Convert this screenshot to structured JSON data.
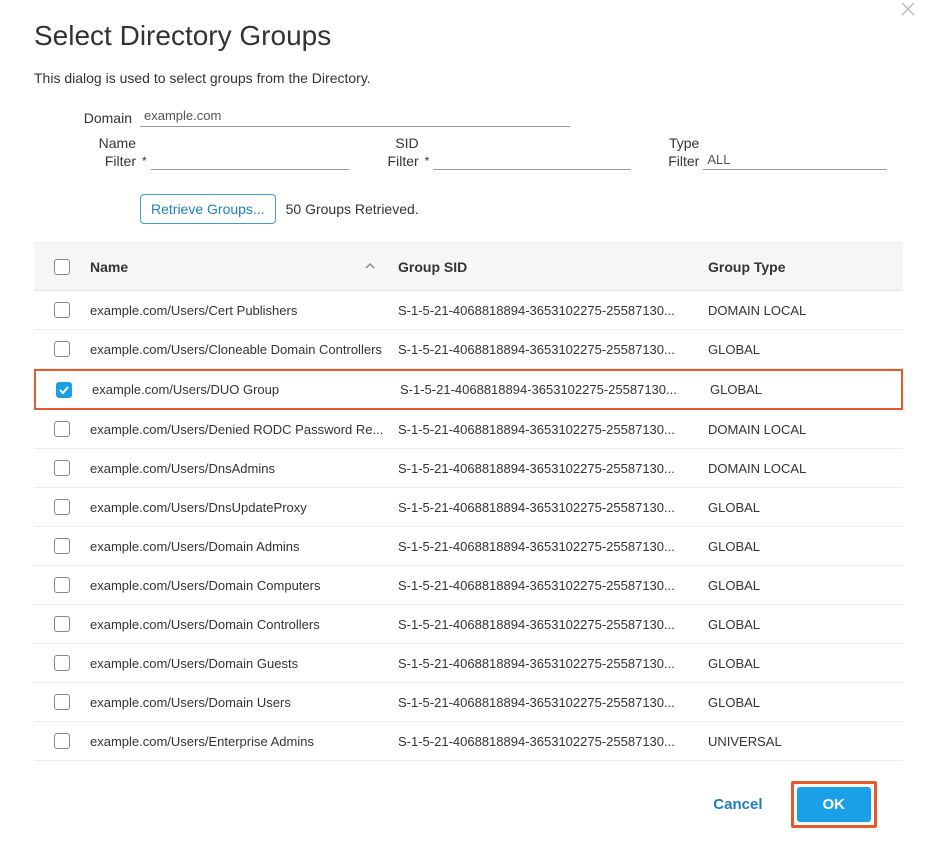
{
  "dialog": {
    "title": "Select Directory Groups",
    "subtitle": "This dialog is used to select groups from the Directory."
  },
  "filters": {
    "domain_label": "Domain",
    "domain_value": "example.com",
    "name_label": "Name Filter",
    "name_value": "",
    "sid_label": "SID Filter",
    "sid_value": "",
    "type_label": "Type Filter",
    "type_value": "ALL"
  },
  "retrieve": {
    "button": "Retrieve Groups...",
    "status": "50 Groups Retrieved."
  },
  "table": {
    "headers": {
      "name": "Name",
      "sid": "Group SID",
      "type": "Group Type"
    },
    "rows": [
      {
        "checked": false,
        "highlight": false,
        "name": "example.com/Users/Cert Publishers",
        "sid": "S-1-5-21-4068818894-3653102275-25587130...",
        "type": "DOMAIN LOCAL"
      },
      {
        "checked": false,
        "highlight": false,
        "name": "example.com/Users/Cloneable Domain Controllers",
        "sid": "S-1-5-21-4068818894-3653102275-25587130...",
        "type": "GLOBAL"
      },
      {
        "checked": true,
        "highlight": true,
        "name": "example.com/Users/DUO Group",
        "sid": "S-1-5-21-4068818894-3653102275-25587130...",
        "type": "GLOBAL"
      },
      {
        "checked": false,
        "highlight": false,
        "name": "example.com/Users/Denied RODC Password Re...",
        "sid": "S-1-5-21-4068818894-3653102275-25587130...",
        "type": "DOMAIN LOCAL"
      },
      {
        "checked": false,
        "highlight": false,
        "name": "example.com/Users/DnsAdmins",
        "sid": "S-1-5-21-4068818894-3653102275-25587130...",
        "type": "DOMAIN LOCAL"
      },
      {
        "checked": false,
        "highlight": false,
        "name": "example.com/Users/DnsUpdateProxy",
        "sid": "S-1-5-21-4068818894-3653102275-25587130...",
        "type": "GLOBAL"
      },
      {
        "checked": false,
        "highlight": false,
        "name": "example.com/Users/Domain Admins",
        "sid": "S-1-5-21-4068818894-3653102275-25587130...",
        "type": "GLOBAL"
      },
      {
        "checked": false,
        "highlight": false,
        "name": "example.com/Users/Domain Computers",
        "sid": "S-1-5-21-4068818894-3653102275-25587130...",
        "type": "GLOBAL"
      },
      {
        "checked": false,
        "highlight": false,
        "name": "example.com/Users/Domain Controllers",
        "sid": "S-1-5-21-4068818894-3653102275-25587130...",
        "type": "GLOBAL"
      },
      {
        "checked": false,
        "highlight": false,
        "name": "example.com/Users/Domain Guests",
        "sid": "S-1-5-21-4068818894-3653102275-25587130...",
        "type": "GLOBAL"
      },
      {
        "checked": false,
        "highlight": false,
        "name": "example.com/Users/Domain Users",
        "sid": "S-1-5-21-4068818894-3653102275-25587130...",
        "type": "GLOBAL"
      },
      {
        "checked": false,
        "highlight": false,
        "name": "example.com/Users/Enterprise Admins",
        "sid": "S-1-5-21-4068818894-3653102275-25587130...",
        "type": "UNIVERSAL"
      }
    ]
  },
  "footer": {
    "cancel": "Cancel",
    "ok": "OK"
  }
}
